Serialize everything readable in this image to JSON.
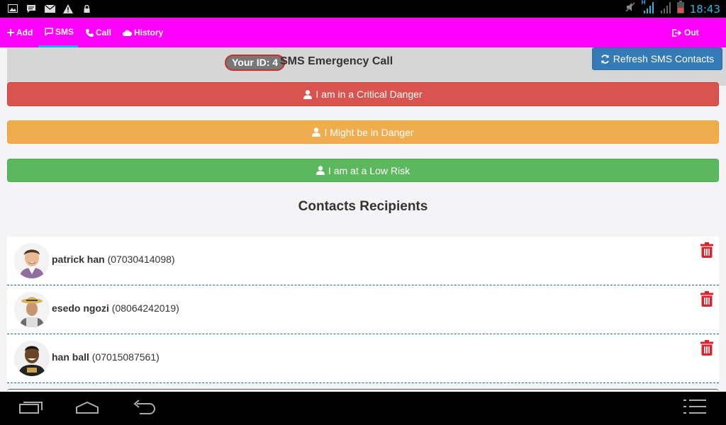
{
  "statusbar": {
    "time": "18:43",
    "left_icons": [
      "picture-icon",
      "message-icon",
      "mail-icon",
      "warning-icon",
      "lock-icon"
    ],
    "right_icons": [
      "mute-icon",
      "signal-icon",
      "signal-weak-icon",
      "battery-icon"
    ],
    "network_label": "H"
  },
  "nav": {
    "items": [
      {
        "label": "Add",
        "icon": "plus-icon"
      },
      {
        "label": "SMS",
        "icon": "sms-icon",
        "active": true
      },
      {
        "label": "Call",
        "icon": "phone-icon"
      },
      {
        "label": "History",
        "icon": "cloud-icon"
      }
    ],
    "logout": {
      "label": "Out",
      "icon": "logout-icon"
    }
  },
  "header": {
    "id_label": "Your ID: 4",
    "title": "SMS Emergency Call",
    "refresh_label": "Refresh SMS Contacts"
  },
  "risk_buttons": {
    "critical": "I am in a Critical Danger",
    "might": "I Might be in Danger",
    "low": "I am at a Low Risk"
  },
  "contacts_title": "Contacts Recipients",
  "contacts": [
    {
      "name": "patrick han",
      "phone": "(07030414098)"
    },
    {
      "name": "esedo ngozi",
      "phone": "(08064242019)"
    },
    {
      "name": "han ball",
      "phone": "(07015087561)"
    }
  ],
  "colors": {
    "appbar": "#ff00ff",
    "critical": "#d9534f",
    "warning": "#f0ad4e",
    "success": "#5cb85c",
    "primary": "#337ab7",
    "trash": "#d9232d"
  }
}
